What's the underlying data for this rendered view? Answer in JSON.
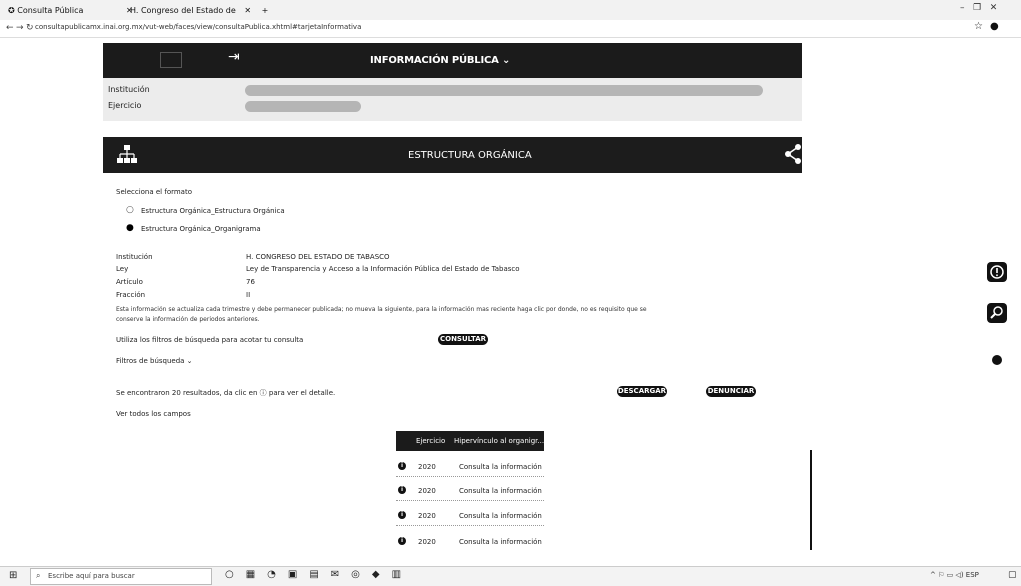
{
  "browser": {
    "tabs": [
      {
        "label": "Consulta Pública"
      },
      {
        "label": "H. Congreso del Estado de"
      }
    ],
    "url": "consultapublicamx.inai.org.mx/vut-web/faces/view/consultaPublica.xhtml#tarjetaInformativa"
  },
  "header": {
    "info_title": "INFORMACIÓN PÚBLICA ⌄"
  },
  "filters": {
    "institucion_label": "Institución",
    "ejercicio_label": "Ejercicio"
  },
  "section": {
    "title": "ESTRUCTURA ORGÁNICA"
  },
  "format": {
    "prompt": "Selecciona el formato",
    "options": [
      {
        "label": "Estructura Orgánica_Estructura Orgánica",
        "selected": false
      },
      {
        "label": "Estructura Orgánica_Organigrama",
        "selected": true
      }
    ]
  },
  "details": {
    "rows": [
      {
        "key": "Institución",
        "value": "H. CONGRESO DEL ESTADO DE TABASCO"
      },
      {
        "key": "Ley",
        "value": "Ley de Transparencia y Acceso a la Información Pública del Estado de Tabasco"
      },
      {
        "key": "Artículo",
        "value": "76"
      },
      {
        "key": "Fracción",
        "value": "II"
      }
    ],
    "note_line1": "Esta información se actualiza cada trimestre y debe permanecer publicada; no mueva la siguiente, para la información mas reciente haga clic por donde, no es requisito que se",
    "note_line2": "conserve la información de periodos anteriores."
  },
  "actions": {
    "hint": "Utiliza los filtros de búsqueda para acotar tu consulta",
    "consultar": "CONSULTAR",
    "filtros": "Filtros de búsqueda ⌄",
    "results": "Se encontraron 20 resultados, da clic en ⓘ para ver el detalle.",
    "descargar": "DESCARGAR",
    "denunciar": "DENUNCIAR",
    "ver_todos": "Ver todos los campos"
  },
  "table": {
    "headers": [
      "Ejercicio",
      "Hipervínculo al organigr..."
    ],
    "rows": [
      {
        "year": "2020",
        "link": "Consulta la información"
      },
      {
        "year": "2020",
        "link": "Consulta la información"
      },
      {
        "year": "2020",
        "link": "Consulta la información"
      },
      {
        "year": "2020",
        "link": "Consulta la información"
      }
    ]
  },
  "taskbar": {
    "search_placeholder": "Escribe aquí para buscar"
  },
  "colors": {
    "header_bg": "#1b1b1b",
    "filter_bg": "#ececec"
  }
}
